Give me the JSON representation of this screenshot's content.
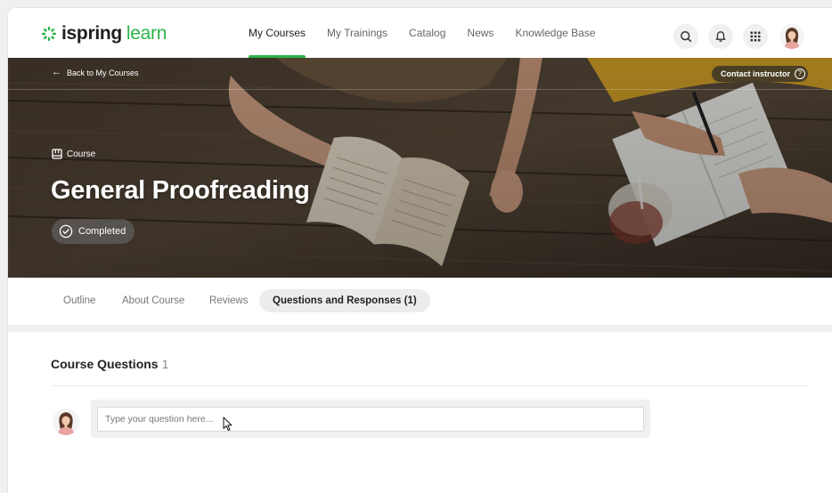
{
  "header": {
    "logo_part1": "ispring",
    "logo_part2": "learn",
    "nav": [
      {
        "label": "My Courses",
        "active": true
      },
      {
        "label": "My Trainings",
        "active": false
      },
      {
        "label": "Catalog",
        "active": false
      },
      {
        "label": "News",
        "active": false
      },
      {
        "label": "Knowledge Base",
        "active": false
      }
    ],
    "icons": [
      "search-icon",
      "bell-icon",
      "apps-grid-icon",
      "user-avatar"
    ]
  },
  "hero": {
    "back_label": "Back to My Courses",
    "contact_label": "Contact instructor",
    "contact_help": "?",
    "type_label": "Course",
    "title": "General Proofreading",
    "status_label": "Completed"
  },
  "tabs": [
    {
      "label": "Outline",
      "active": false
    },
    {
      "label": "About Course",
      "active": false
    },
    {
      "label": "Reviews",
      "active": false
    },
    {
      "label": "Questions and Responses (1)",
      "active": true
    }
  ],
  "questions": {
    "heading": "Course Questions",
    "count": "1",
    "input_placeholder": "Type your question here...",
    "input_value": ""
  },
  "colors": {
    "accent": "#2cb34a",
    "text": "#222222",
    "muted": "#777777",
    "tab_active_bg": "#ececec"
  }
}
